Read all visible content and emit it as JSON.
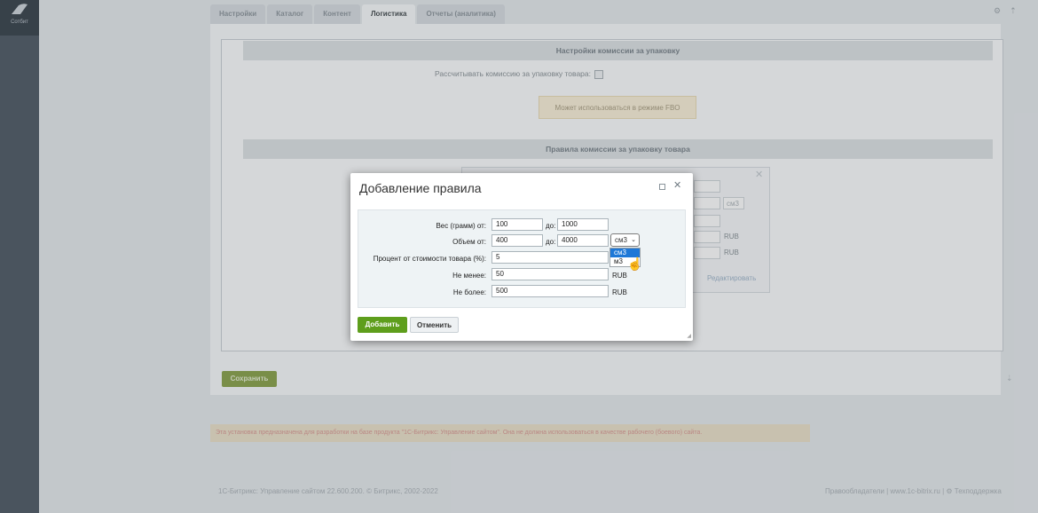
{
  "sidebar": {
    "logo_label": "Сотбит"
  },
  "tabs": [
    {
      "label": "Настройки"
    },
    {
      "label": "Каталог"
    },
    {
      "label": "Контент"
    },
    {
      "label": "Логистика"
    },
    {
      "label": "Отчеты (аналитика)"
    }
  ],
  "packaging": {
    "section_title": "Настройки комиссии за упаковку",
    "calc_label": "Рассчитывать комиссию за упаковку товара:",
    "fbo_note": "Может использоваться в режиме FBO"
  },
  "rules": {
    "section_title": "Правила комиссии за упаковку товара",
    "bg_unit_volume": "см3",
    "bg_unit_rub1": "RUB",
    "bg_unit_rub2": "RUB",
    "bg_edit_link": "Редактировать"
  },
  "save_label": "Сохранить",
  "warning": "Эта установка предназначена для разработки на базе продукта \"1С-Битрикс: Управление сайтом\". Она не должна использоваться в качестве рабочего (боевого) сайта.",
  "footer": {
    "left": "1С-Битрикс: Управление сайтом 22.600.200. © Битрикс, 2002-2022",
    "right": "Правообладатели  |  www.1c-bitrix.ru  |  ⚙ Техподдержка"
  },
  "dialog": {
    "title": "Добавление правила",
    "weight_label": "Вес (грамм) от:",
    "weight_from": "100",
    "to_label": "до:",
    "weight_to": "1000",
    "volume_label": "Объем от:",
    "volume_from": "400",
    "volume_to": "4000",
    "volume_unit_selected": "см3",
    "volume_unit_options": [
      "см3",
      "м3"
    ],
    "percent_label": "Процент от стоимости товара (%):",
    "percent_value": "5",
    "min_label": "Не менее:",
    "min_value": "50",
    "max_label": "Не более:",
    "max_value": "500",
    "currency": "RUB",
    "add_label": "Добавить",
    "cancel_label": "Отменить"
  }
}
